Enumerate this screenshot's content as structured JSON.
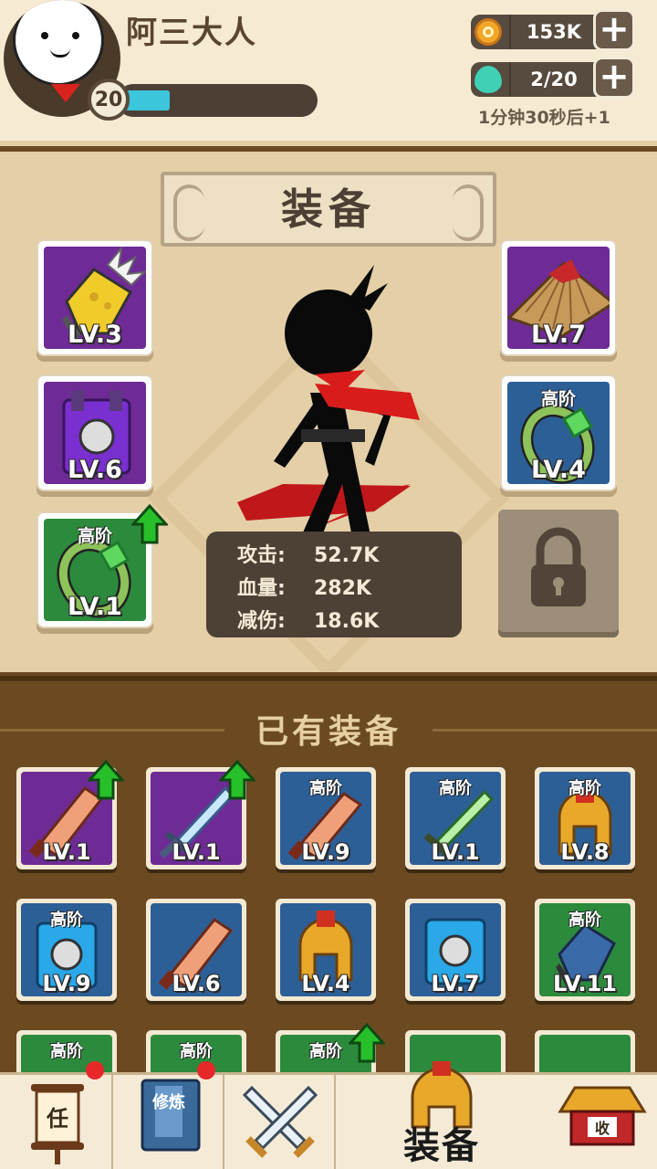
{
  "player": {
    "name": "阿三大人",
    "level": "20",
    "xp_fraction": 0.25
  },
  "resources": {
    "coins": {
      "icon": "coin-icon",
      "value": "153K"
    },
    "energy": {
      "icon": "balloon-icon",
      "value": "2/20"
    },
    "regen_text": "1分钟30秒后+1"
  },
  "equipment": {
    "title": "装备",
    "slots": {
      "glove": {
        "level": "LV.3"
      },
      "hat": {
        "level": "LV.7"
      },
      "armor": {
        "level": "LV.6"
      },
      "ring_blue": {
        "tier": "高阶",
        "level": "LV.4"
      },
      "ring_green": {
        "tier": "高阶",
        "level": "LV.1"
      }
    },
    "stats": [
      {
        "label": "攻击:",
        "value": "52.7K"
      },
      {
        "label": "血量:",
        "value": "282K"
      },
      {
        "label": "减伤:",
        "value": "18.6K"
      }
    ]
  },
  "owned": {
    "title": "已有装备",
    "row1": [
      {
        "tier": "",
        "level": "LV.1"
      },
      {
        "tier": "",
        "level": "LV.1"
      },
      {
        "tier": "高阶",
        "level": "LV.9"
      },
      {
        "tier": "高阶",
        "level": "LV.1"
      },
      {
        "tier": "高阶",
        "level": "LV.8"
      }
    ],
    "row2": [
      {
        "tier": "高阶",
        "level": "LV.9"
      },
      {
        "tier": "",
        "level": "LV.6"
      },
      {
        "tier": "",
        "level": "LV.4"
      },
      {
        "tier": "",
        "level": "LV.7"
      },
      {
        "tier": "高阶",
        "level": "LV.11"
      }
    ],
    "row3": [
      {
        "tier": "高阶"
      },
      {
        "tier": "高阶"
      },
      {
        "tier": "高阶"
      },
      {
        "tier": ""
      },
      {
        "tier": ""
      }
    ]
  },
  "nav": {
    "tasks_glyph": "任",
    "cultivate_glyph": "修炼",
    "active_label": "装备",
    "collect_glyph": "收"
  },
  "colors": {
    "xp": "#3bc6dc",
    "upgrade": "#27c02a",
    "notify": "#e6282a"
  }
}
